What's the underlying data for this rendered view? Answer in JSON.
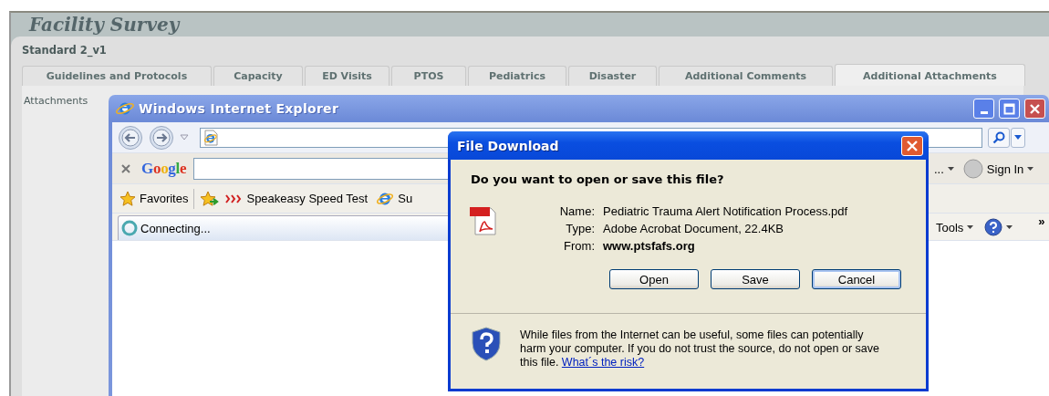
{
  "page": {
    "title": "Facility Survey",
    "subtitle": "Standard 2_v1",
    "section_label": "Attachments",
    "tabs": [
      {
        "label": "Guidelines and Protocols",
        "selected": false
      },
      {
        "label": "Capacity",
        "selected": false
      },
      {
        "label": "ED Visits",
        "selected": false
      },
      {
        "label": "PTOS",
        "selected": false
      },
      {
        "label": "Pediatrics",
        "selected": false
      },
      {
        "label": "Disaster",
        "selected": false
      },
      {
        "label": "Additional Comments",
        "selected": false
      },
      {
        "label": "Additional Attachments",
        "selected": true
      }
    ]
  },
  "browser": {
    "title": "Windows Internet Explorer",
    "google": "Google",
    "toolbar_overflow": "...",
    "sign_in": "Sign In",
    "favorites_label": "Favorites",
    "favorites": [
      {
        "label": "Speakeasy Speed Test",
        "kind": "chevrons"
      },
      {
        "label": "Su",
        "kind": "browser"
      }
    ],
    "tab_label": "Connecting...",
    "tools": "Tools",
    "more": "»"
  },
  "dialog": {
    "title": "File Download",
    "question": "Do you want to open or save this file?",
    "fields": [
      {
        "label": "Name:",
        "value": "Pediatric Trauma Alert Notification Process.pdf",
        "bold": false
      },
      {
        "label": "Type:",
        "value": "Adobe Acrobat Document, 22.4KB",
        "bold": false
      },
      {
        "label": "From:",
        "value": "www.ptsfafs.org",
        "bold": true
      }
    ],
    "buttons": [
      {
        "label": "Open",
        "default": false
      },
      {
        "label": "Save",
        "default": false
      },
      {
        "label": "Cancel",
        "default": true
      }
    ],
    "warning": "While files from the Internet can be useful, some files can potentially harm your computer. If you do not trust the source, do not open or save this file.",
    "link": "What´s the risk?"
  }
}
